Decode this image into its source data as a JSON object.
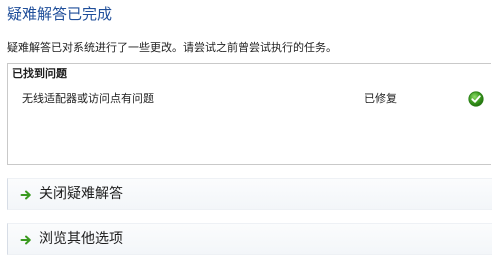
{
  "page": {
    "title": "疑难解答已完成",
    "description": "疑难解答已对系统进行了一些更改。请尝试之前曾尝试执行的任务。"
  },
  "problems": {
    "header": "已找到问题",
    "items": [
      {
        "name": "无线适配器或访问点有问题",
        "status": "已修复",
        "status_icon": "green-check-icon"
      }
    ]
  },
  "actions": [
    {
      "label": "关闭疑难解答",
      "icon": "green-arrow-right-icon"
    },
    {
      "label": "浏览其他选项",
      "icon": "green-arrow-right-icon"
    }
  ],
  "colors": {
    "title": "#1f4e9a",
    "accent_green": "#3a9a1f",
    "border": "#c9c9c9"
  }
}
